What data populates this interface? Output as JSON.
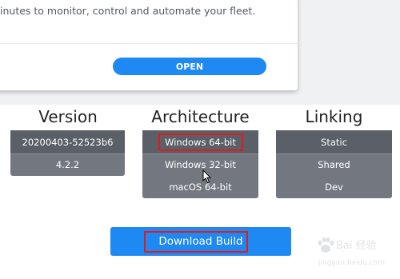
{
  "modal": {
    "description": "inutes to monitor, control and automate your fleet.",
    "open_label": "OPEN"
  },
  "columns": {
    "version": {
      "title": "Version",
      "options": [
        "20200403-52523b6",
        "4.2.2"
      ],
      "selected": "20200403-52523b6"
    },
    "architecture": {
      "title": "Architecture",
      "options": [
        "Windows 64-bit",
        "Windows 32-bit",
        "macOS 64-bit"
      ],
      "selected": "Windows 64-bit"
    },
    "linking": {
      "title": "Linking",
      "options": [
        "Static",
        "Shared",
        "Dev"
      ],
      "selected": "Static"
    }
  },
  "download": {
    "label": "Download Build"
  },
  "watermark": {
    "text": "Bai 经验",
    "url": "jingyan.baidu.com"
  },
  "colors": {
    "accent_blue": "#1e88f3",
    "panel_gray": "#737880",
    "selected_gray": "#5b6068",
    "highlight_red": "#e11a1a"
  }
}
